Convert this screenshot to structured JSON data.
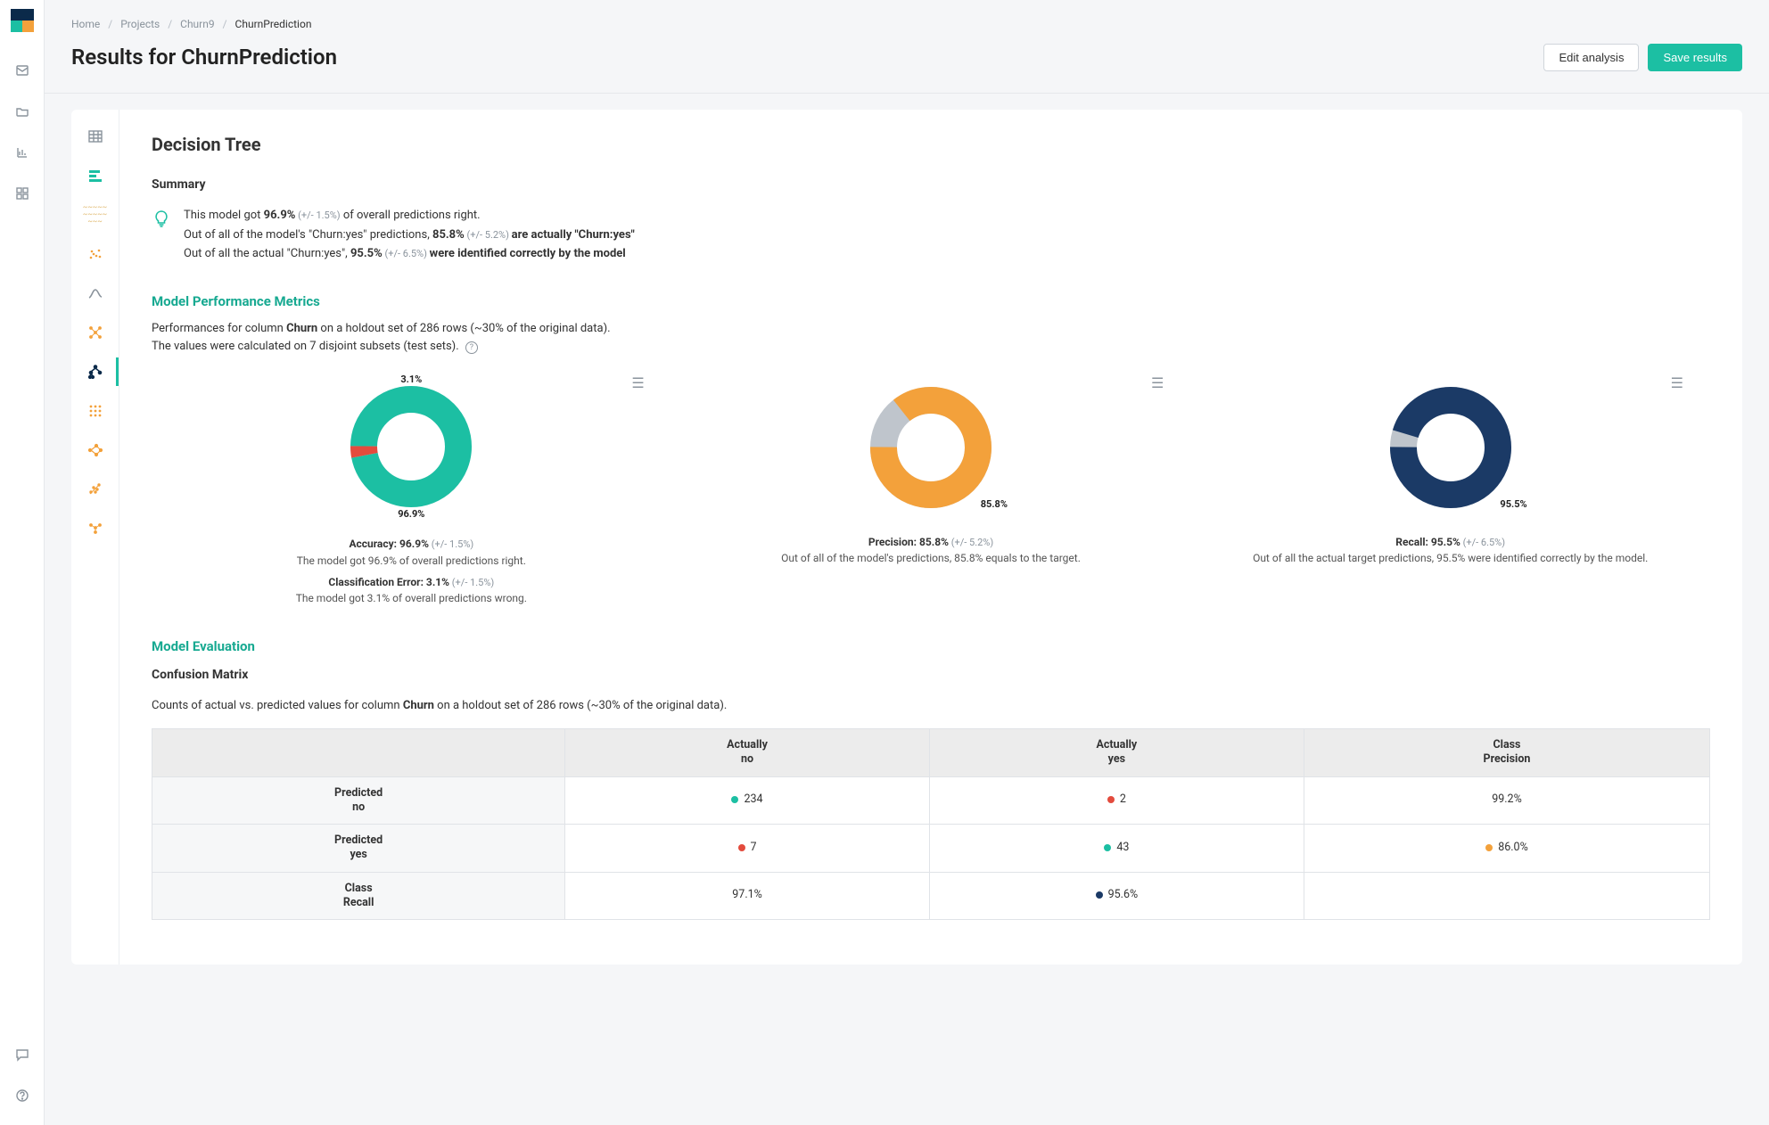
{
  "breadcrumb": {
    "home": "Home",
    "projects": "Projects",
    "project": "Churn9",
    "current": "ChurnPrediction"
  },
  "page_title": "Results for ChurnPrediction",
  "buttons": {
    "edit": "Edit analysis",
    "save": "Save results"
  },
  "section": {
    "title": "Decision Tree",
    "summary_heading": "Summary"
  },
  "summary": {
    "l1_a": "This model got ",
    "l1_b": "96.9%",
    "l1_c": " (+/- 1.5%)",
    "l1_d": " of overall predictions right.",
    "l2_a": "Out of all of the model's \"Churn:yes\" predictions, ",
    "l2_b": "85.8%",
    "l2_c": " (+/- 5.2%) ",
    "l2_d": "are actually \"Churn:yes\"",
    "l3_a": "Out of all the actual \"Churn:yes\", ",
    "l3_b": "95.5%",
    "l3_c": " (+/- 6.5%) ",
    "l3_d": "were identified correctly by the model"
  },
  "metrics": {
    "heading": "Model Performance Metrics",
    "desc_a": "Performances for column ",
    "desc_b": "Churn",
    "desc_c": " on a holdout set of 286 rows (~30% of the original data).",
    "desc2": "The values were calculated on 7 disjoint subsets (test sets)."
  },
  "chart_data": [
    {
      "type": "pie",
      "title": "Accuracy",
      "series": [
        {
          "name": "Accuracy",
          "value": 96.9,
          "color": "#1cbfa3"
        },
        {
          "name": "Error",
          "value": 3.1,
          "color": "#e34b3d"
        }
      ],
      "labels": {
        "top": "3.1%",
        "bottom": "96.9%"
      },
      "caption": {
        "title": "Accuracy: 96.9%",
        "pm": " (+/- 1.5%)",
        "sub": "The model got 96.9% of overall predictions right.",
        "title2": "Classification Error: 3.1%",
        "pm2": " (+/- 1.5%)",
        "sub2": "The model got 3.1% of overall predictions wrong."
      }
    },
    {
      "type": "pie",
      "title": "Precision",
      "series": [
        {
          "name": "Precision",
          "value": 85.8,
          "color": "#f3a13b"
        },
        {
          "name": "Remainder",
          "value": 14.2,
          "color": "#bfc5cc"
        }
      ],
      "labels": {
        "bottom": "85.8%"
      },
      "caption": {
        "title": "Precision: 85.8%",
        "pm": " (+/- 5.2%)",
        "sub": "Out of all of the model's predictions, 85.8% equals to the target."
      }
    },
    {
      "type": "pie",
      "title": "Recall",
      "series": [
        {
          "name": "Recall",
          "value": 95.5,
          "color": "#1b3a66"
        },
        {
          "name": "Remainder",
          "value": 4.5,
          "color": "#bfc5cc"
        }
      ],
      "labels": {
        "bottom": "95.5%"
      },
      "caption": {
        "title": "Recall: 95.5%",
        "pm": " (+/- 6.5%)",
        "sub": "Out of all the actual target predictions, 95.5% were identified correctly by the model."
      }
    }
  ],
  "evaluation": {
    "heading": "Model Evaluation",
    "cm_heading": "Confusion Matrix",
    "cm_desc_a": "Counts of actual vs. predicted values for column ",
    "cm_desc_b": "Churn",
    "cm_desc_c": " on a holdout set of 286 rows (~30% of the original data).",
    "cols": {
      "blank": "",
      "a_no_t": "Actually",
      "a_no_b": "no",
      "a_yes_t": "Actually",
      "a_yes_b": "yes",
      "cp_t": "Class",
      "cp_b": "Precision"
    },
    "rows": {
      "p_no_t": "Predicted",
      "p_no_b": "no",
      "p_yes_t": "Predicted",
      "p_yes_b": "yes",
      "cr_t": "Class",
      "cr_b": "Recall"
    },
    "cells": {
      "r1c1": "234",
      "r1c2": "2",
      "r1c3": "99.2%",
      "r2c1": "7",
      "r2c2": "43",
      "r2c3": "86.0%",
      "r3c1": "97.1%",
      "r3c2": "95.6%",
      "r3c3": ""
    }
  }
}
